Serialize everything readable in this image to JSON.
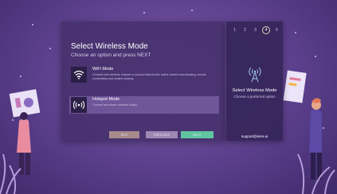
{
  "screen": {
    "title": "Select Wireless Mode",
    "subtitle": "Choose an option and press NEXT"
  },
  "options": [
    {
      "icon": "wifi-icon",
      "title": "WiFi Mode",
      "description": "Connect with wireless network to access features like online content downloading, remote connectivity and content sharing."
    },
    {
      "icon": "hotspot-icon",
      "title": "Hotspot Mode",
      "description": "Connect and share contents locally.",
      "selected": true
    }
  ],
  "buttons": {
    "skip": "SKIP",
    "previous": "PREVIOUS",
    "next": "NEXT"
  },
  "stepper": {
    "steps": [
      "1",
      "2",
      "3",
      "4",
      "5"
    ],
    "active": "4"
  },
  "side_panel": {
    "icon": "antenna-icon",
    "title": "Select Wireless Mode",
    "subtitle": "Choose a preferred option",
    "support": "support@eins.ai"
  },
  "colors": {
    "skip_button": "#a78a8c",
    "previous_button": "#9e88b4",
    "next_button": "#5fc6a1",
    "active_step_ring": "#e5d6b3"
  }
}
